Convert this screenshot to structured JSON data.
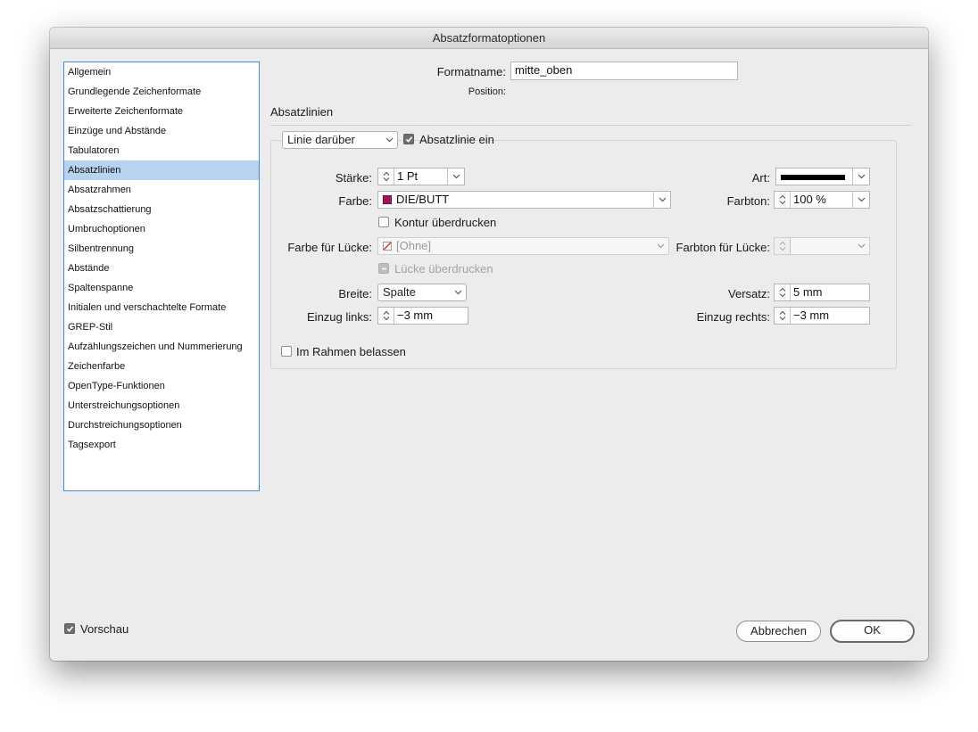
{
  "window": {
    "title": "Absatzformatoptionen"
  },
  "sidebar": {
    "items": [
      {
        "label": "Allgemein"
      },
      {
        "label": "Grundlegende Zeichenformate"
      },
      {
        "label": "Erweiterte Zeichenformate"
      },
      {
        "label": "Einzüge und Abstände"
      },
      {
        "label": "Tabulatoren"
      },
      {
        "label": "Absatzlinien",
        "selected": true
      },
      {
        "label": "Absatzrahmen"
      },
      {
        "label": "Absatzschattierung"
      },
      {
        "label": "Umbruchoptionen"
      },
      {
        "label": "Silbentrennung"
      },
      {
        "label": "Abstände"
      },
      {
        "label": "Spaltenspanne"
      },
      {
        "label": "Initialen und verschachtelte Formate"
      },
      {
        "label": "GREP-Stil"
      },
      {
        "label": "Aufzählungszeichen und Nummerierung"
      },
      {
        "label": "Zeichenfarbe"
      },
      {
        "label": "OpenType-Funktionen"
      },
      {
        "label": "Unterstreichungsoptionen"
      },
      {
        "label": "Durchstreichungsoptionen"
      },
      {
        "label": "Tagsexport"
      }
    ]
  },
  "header": {
    "formatname_label": "Formatname:",
    "formatname_value": "mitte_oben",
    "position_label": "Position:"
  },
  "section": {
    "title": "Absatzlinien",
    "line_position": "Linie darüber",
    "line_on_label": "Absatzlinie ein",
    "line_on_checked": true,
    "staerke_label": "Stärke:",
    "staerke_value": "1 Pt",
    "art_label": "Art:",
    "farbe_label": "Farbe:",
    "farbe_value": "DIE/BUTT",
    "farbe_color": "#a8105e",
    "farbton_label": "Farbton:",
    "farbton_value": "100 %",
    "kontur_label": "Kontur überdrucken",
    "kontur_checked": false,
    "luecke_farbe_label": "Farbe für Lücke:",
    "luecke_farbe_value": "[Ohne]",
    "luecke_farbton_label": "Farbton für Lücke:",
    "luecke_ueberdrucken_label": "Lücke überdrucken",
    "breite_label": "Breite:",
    "breite_value": "Spalte",
    "versatz_label": "Versatz:",
    "versatz_value": "5 mm",
    "einzug_links_label": "Einzug links:",
    "einzug_links_value": "−3 mm",
    "einzug_rechts_label": "Einzug rechts:",
    "einzug_rechts_value": "−3 mm",
    "im_rahmen_label": "Im Rahmen belassen",
    "im_rahmen_checked": false
  },
  "footer": {
    "vorschau_label": "Vorschau",
    "vorschau_checked": true,
    "cancel_label": "Abbrechen",
    "ok_label": "OK"
  }
}
